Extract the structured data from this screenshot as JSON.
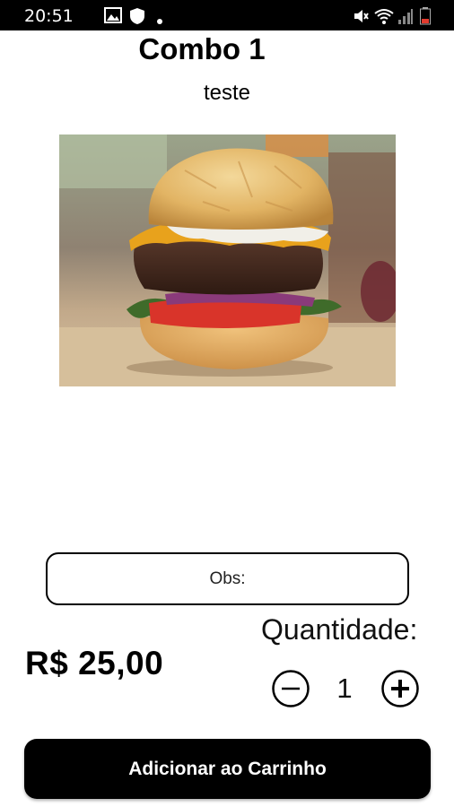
{
  "status_bar": {
    "time": "20:51",
    "icons": [
      "image-icon",
      "shield-icon",
      "dot-icon",
      "mute-icon",
      "wifi-icon",
      "signal-icon",
      "battery-icon"
    ]
  },
  "product": {
    "title": "Combo 1",
    "description": "teste",
    "image": "burger-photo",
    "price": "R$ 25,00"
  },
  "obs": {
    "label": "Obs:"
  },
  "quantity": {
    "label": "Quantidade:",
    "value": "1"
  },
  "actions": {
    "add_to_cart": "Adicionar ao Carrinho"
  },
  "colors": {
    "primary": "#000000",
    "background": "#ffffff",
    "button_text": "#ffffff"
  }
}
